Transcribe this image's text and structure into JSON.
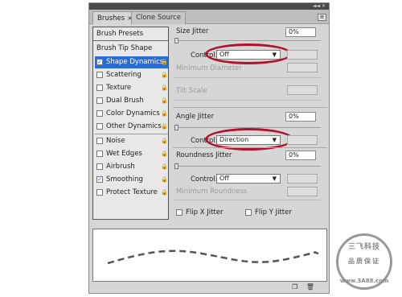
{
  "tabs": [
    {
      "label": "Brushes",
      "close": "×"
    },
    {
      "label": "Clone Source"
    }
  ],
  "panel_menu_glyph": "≡",
  "window_buttons": "◄◄ ✕",
  "left": {
    "presets": "Brush Presets",
    "tip_shape": "Brush Tip Shape",
    "options": [
      {
        "label": "Shape Dynamics",
        "checked": "✓",
        "selected": true
      },
      {
        "label": "Scattering",
        "checked": ""
      },
      {
        "label": "Texture",
        "checked": ""
      },
      {
        "label": "Dual Brush",
        "checked": ""
      },
      {
        "label": "Color Dynamics",
        "checked": ""
      },
      {
        "label": "Other Dynamics",
        "checked": ""
      },
      {
        "label": "Noise",
        "checked": ""
      },
      {
        "label": "Wet Edges",
        "checked": ""
      },
      {
        "label": "Airbrush",
        "checked": ""
      },
      {
        "label": "Smoothing",
        "checked": "✓"
      },
      {
        "label": "Protect Texture",
        "checked": ""
      }
    ]
  },
  "right": {
    "size_jitter": {
      "label": "Size Jitter",
      "value": "0%"
    },
    "control1": {
      "label": "Control:",
      "value": "Off"
    },
    "min_diameter": {
      "label": "Minimum Diameter"
    },
    "tilt_scale": {
      "label": "Tilt Scale"
    },
    "angle_jitter": {
      "label": "Angle Jitter",
      "value": "0%"
    },
    "control2": {
      "label": "Control:",
      "value": "Direction"
    },
    "roundness_jitter": {
      "label": "Roundness Jitter",
      "value": "0%"
    },
    "control3": {
      "label": "Control:",
      "value": "Off"
    },
    "min_roundness": {
      "label": "Minimum Roundness"
    },
    "flip_x": {
      "label": "Flip X Jitter"
    },
    "flip_y": {
      "label": "Flip Y Jitter"
    },
    "dropdown_arrow": "▼"
  },
  "bottom_icons": [
    "❐",
    "🗑"
  ],
  "watermark": {
    "top": "三飞科技",
    "mid": "品质保证",
    "bot": "www.3A88.com"
  },
  "colors": {
    "selection": "#2a6cd6",
    "highlight_ring": "#b0122c"
  }
}
